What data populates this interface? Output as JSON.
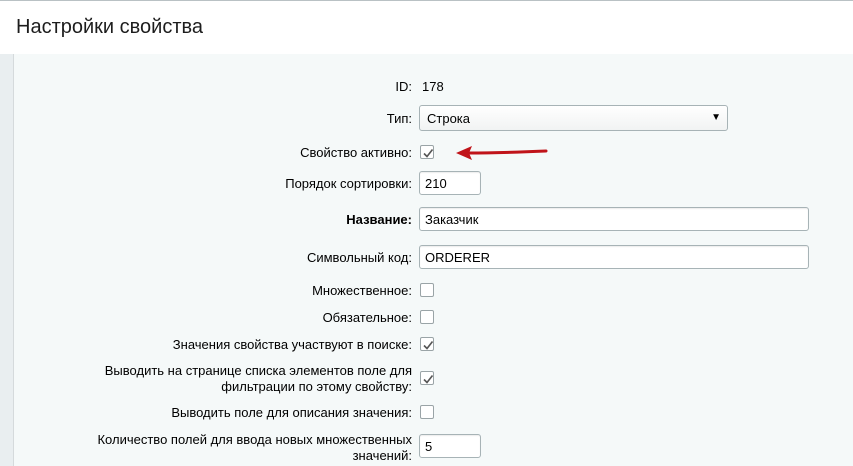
{
  "header": {
    "title": "Настройки свойства"
  },
  "form": {
    "id": {
      "label": "ID:",
      "value": "178"
    },
    "type": {
      "label": "Тип:",
      "value": "Строка"
    },
    "active": {
      "label": "Свойство активно:",
      "checked": true
    },
    "sort": {
      "label": "Порядок сортировки:",
      "value": "210"
    },
    "name": {
      "label": "Название:",
      "value": "Заказчик"
    },
    "code": {
      "label": "Символьный код:",
      "value": "ORDERER"
    },
    "multiple": {
      "label": "Множественное:",
      "checked": false
    },
    "required": {
      "label": "Обязательное:",
      "checked": false
    },
    "searchable": {
      "label": "Значения свойства участвуют в поиске:",
      "checked": true
    },
    "filterable": {
      "label": "Выводить на странице списка элементов поле для фильтрации по этому свойству:",
      "checked": true
    },
    "with_description": {
      "label": "Выводить поле для описания значения:",
      "checked": false
    },
    "multiple_count": {
      "label": "Количество полей для ввода новых множественных значений:",
      "value": "5"
    }
  },
  "annotation": {
    "arrow_color": "#c0141a"
  }
}
